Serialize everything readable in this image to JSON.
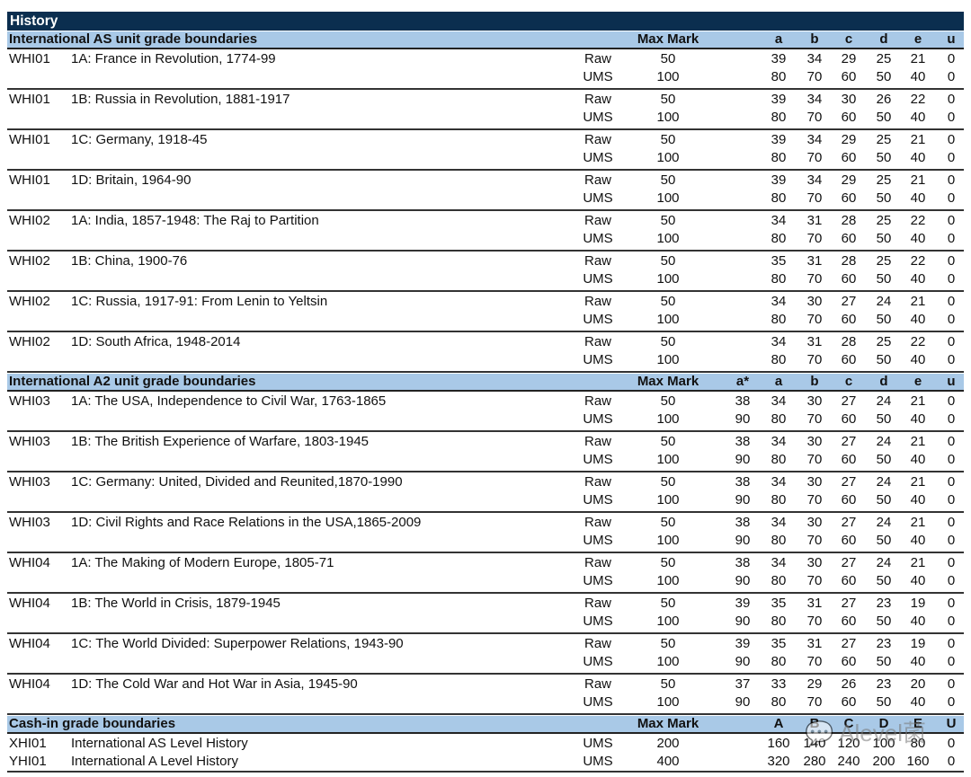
{
  "title": "History",
  "as": {
    "heading": "International AS unit grade boundaries",
    "max_label": "Max Mark",
    "grades": [
      "a",
      "b",
      "c",
      "d",
      "e",
      "u"
    ],
    "units": [
      {
        "code": "WHI01",
        "name": "1A: France in Revolution, 1774-99",
        "raw_max": "50",
        "ums_max": "100",
        "raw": [
          "39",
          "34",
          "29",
          "25",
          "21",
          "0"
        ],
        "ums": [
          "80",
          "70",
          "60",
          "50",
          "40",
          "0"
        ]
      },
      {
        "code": "WHI01",
        "name": "1B: Russia in Revolution, 1881-1917",
        "raw_max": "50",
        "ums_max": "100",
        "raw": [
          "39",
          "34",
          "30",
          "26",
          "22",
          "0"
        ],
        "ums": [
          "80",
          "70",
          "60",
          "50",
          "40",
          "0"
        ]
      },
      {
        "code": "WHI01",
        "name": "1C: Germany, 1918-45",
        "raw_max": "50",
        "ums_max": "100",
        "raw": [
          "39",
          "34",
          "29",
          "25",
          "21",
          "0"
        ],
        "ums": [
          "80",
          "70",
          "60",
          "50",
          "40",
          "0"
        ]
      },
      {
        "code": "WHI01",
        "name": "1D: Britain, 1964-90",
        "raw_max": "50",
        "ums_max": "100",
        "raw": [
          "39",
          "34",
          "29",
          "25",
          "21",
          "0"
        ],
        "ums": [
          "80",
          "70",
          "60",
          "50",
          "40",
          "0"
        ]
      },
      {
        "code": "WHI02",
        "name": "1A: India, 1857-1948: The Raj to Partition",
        "raw_max": "50",
        "ums_max": "100",
        "raw": [
          "34",
          "31",
          "28",
          "25",
          "22",
          "0"
        ],
        "ums": [
          "80",
          "70",
          "60",
          "50",
          "40",
          "0"
        ]
      },
      {
        "code": "WHI02",
        "name": "1B: China, 1900-76",
        "raw_max": "50",
        "ums_max": "100",
        "raw": [
          "35",
          "31",
          "28",
          "25",
          "22",
          "0"
        ],
        "ums": [
          "80",
          "70",
          "60",
          "50",
          "40",
          "0"
        ]
      },
      {
        "code": "WHI02",
        "name": "1C: Russia, 1917-91: From Lenin to Yeltsin",
        "raw_max": "50",
        "ums_max": "100",
        "raw": [
          "34",
          "30",
          "27",
          "24",
          "21",
          "0"
        ],
        "ums": [
          "80",
          "70",
          "60",
          "50",
          "40",
          "0"
        ]
      },
      {
        "code": "WHI02",
        "name": "1D: South Africa, 1948-2014",
        "raw_max": "50",
        "ums_max": "100",
        "raw": [
          "34",
          "31",
          "28",
          "25",
          "22",
          "0"
        ],
        "ums": [
          "80",
          "70",
          "60",
          "50",
          "40",
          "0"
        ]
      }
    ]
  },
  "a2": {
    "heading": "International A2 unit grade boundaries",
    "max_label": "Max Mark",
    "grades": [
      "a*",
      "a",
      "b",
      "c",
      "d",
      "e",
      "u"
    ],
    "units": [
      {
        "code": "WHI03",
        "name": "1A: The USA, Independence to Civil War, 1763-1865",
        "raw_max": "50",
        "ums_max": "100",
        "raw": [
          "38",
          "34",
          "30",
          "27",
          "24",
          "21",
          "0"
        ],
        "ums": [
          "90",
          "80",
          "70",
          "60",
          "50",
          "40",
          "0"
        ]
      },
      {
        "code": "WHI03",
        "name": "1B: The British Experience of Warfare, 1803-1945",
        "raw_max": "50",
        "ums_max": "100",
        "raw": [
          "38",
          "34",
          "30",
          "27",
          "24",
          "21",
          "0"
        ],
        "ums": [
          "90",
          "80",
          "70",
          "60",
          "50",
          "40",
          "0"
        ]
      },
      {
        "code": "WHI03",
        "name": "1C: Germany: United, Divided and Reunited,1870-1990",
        "raw_max": "50",
        "ums_max": "100",
        "raw": [
          "38",
          "34",
          "30",
          "27",
          "24",
          "21",
          "0"
        ],
        "ums": [
          "90",
          "80",
          "70",
          "60",
          "50",
          "40",
          "0"
        ]
      },
      {
        "code": "WHI03",
        "name": "1D: Civil Rights and Race Relations in the USA,1865-2009",
        "raw_max": "50",
        "ums_max": "100",
        "raw": [
          "38",
          "34",
          "30",
          "27",
          "24",
          "21",
          "0"
        ],
        "ums": [
          "90",
          "80",
          "70",
          "60",
          "50",
          "40",
          "0"
        ]
      },
      {
        "code": "WHI04",
        "name": "1A: The Making of Modern Europe, 1805-71",
        "raw_max": "50",
        "ums_max": "100",
        "raw": [
          "38",
          "34",
          "30",
          "27",
          "24",
          "21",
          "0"
        ],
        "ums": [
          "90",
          "80",
          "70",
          "60",
          "50",
          "40",
          "0"
        ]
      },
      {
        "code": "WHI04",
        "name": "1B: The World in Crisis, 1879-1945",
        "raw_max": "50",
        "ums_max": "100",
        "raw": [
          "39",
          "35",
          "31",
          "27",
          "23",
          "19",
          "0"
        ],
        "ums": [
          "90",
          "80",
          "70",
          "60",
          "50",
          "40",
          "0"
        ]
      },
      {
        "code": "WHI04",
        "name": "1C: The World Divided: Superpower Relations, 1943-90",
        "raw_max": "50",
        "ums_max": "100",
        "raw": [
          "39",
          "35",
          "31",
          "27",
          "23",
          "19",
          "0"
        ],
        "ums": [
          "90",
          "80",
          "70",
          "60",
          "50",
          "40",
          "0"
        ]
      },
      {
        "code": "WHI04",
        "name": "1D: The Cold War and Hot War in Asia, 1945-90",
        "raw_max": "50",
        "ums_max": "100",
        "raw": [
          "37",
          "33",
          "29",
          "26",
          "23",
          "20",
          "0"
        ],
        "ums": [
          "90",
          "80",
          "70",
          "60",
          "50",
          "40",
          "0"
        ]
      }
    ]
  },
  "cash": {
    "heading": "Cash-in grade boundaries",
    "max_label": "Max Mark",
    "grades": [
      "A",
      "B",
      "C",
      "D",
      "E",
      "U"
    ],
    "rows": [
      {
        "code": "XHI01",
        "name": "International AS Level History",
        "type": "UMS",
        "max": "200",
        "values": [
          "160",
          "140",
          "120",
          "100",
          "80",
          "0"
        ]
      },
      {
        "code": "YHI01",
        "name": "International A Level History",
        "type": "UMS",
        "max": "400",
        "values": [
          "320",
          "280",
          "240",
          "200",
          "160",
          "0"
        ]
      }
    ]
  },
  "watermark": "Alevel菌"
}
